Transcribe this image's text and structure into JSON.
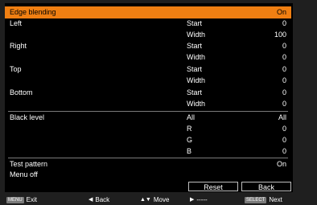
{
  "menu": {
    "edge_blending": {
      "label": "Edge blending",
      "value": "On"
    },
    "left": {
      "label": "Left",
      "start_label": "Start",
      "start_value": "0",
      "width_label": "Width",
      "width_value": "100"
    },
    "right": {
      "label": "Right",
      "start_label": "Start",
      "start_value": "0",
      "width_label": "Width",
      "width_value": "0"
    },
    "top": {
      "label": "Top",
      "start_label": "Start",
      "start_value": "0",
      "width_label": "Width",
      "width_value": "0"
    },
    "bottom": {
      "label": "Bottom",
      "start_label": "Start",
      "start_value": "0",
      "width_label": "Width",
      "width_value": "0"
    },
    "black_level": {
      "label": "Black level",
      "all_label": "All",
      "all_value": "All",
      "r_label": "R",
      "r_value": "0",
      "g_label": "G",
      "g_value": "0",
      "b_label": "B",
      "b_value": "0"
    },
    "test_pattern": {
      "label": "Test pattern",
      "value": "On"
    },
    "menu_off": {
      "label": "Menu off"
    }
  },
  "buttons": {
    "reset": "Reset",
    "back": "Back"
  },
  "footer": {
    "menu_key": "MENU",
    "exit": "Exit",
    "back": "Back",
    "move": "Move",
    "placeholder": "-----",
    "select_key": "SELECT",
    "next": "Next"
  },
  "colors": {
    "highlight": "#f07f12",
    "background": "#000000",
    "text": "#ffffff"
  }
}
